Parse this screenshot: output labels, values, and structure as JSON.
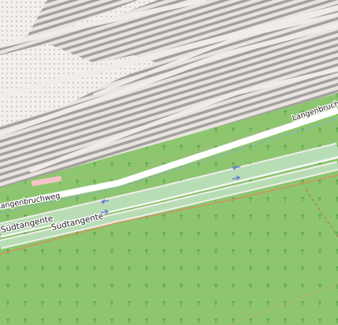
{
  "map": {
    "style": "OpenStreetMap Carto",
    "colors": {
      "meadow": "#8dc66f",
      "tree_dot": "#5da54a",
      "rail_yard_ground": "#e9e4e0",
      "rail_track": "#9d9b99",
      "gravel": "#f3efed",
      "gravel_dot": "#b7b1ad",
      "white_road": "#ffffff",
      "trunk_fill": "#b8ddb5",
      "trunk_casing": "#f0eeec",
      "oneway_arrow": "#6b7ed8",
      "footpath": "#f08070",
      "track_brown": "#a88a4a",
      "cycleway": "#8aa8dc",
      "bridge_pink": "#f2c6c6"
    },
    "road_labels": [
      {
        "id": "langenbruchweg_right",
        "text": "Langenbruchweg"
      },
      {
        "id": "langenbruchweg_left",
        "text": "Langenbruchweg"
      },
      {
        "id": "suedtangente_1",
        "text": "Südtangente"
      },
      {
        "id": "suedtangente_2",
        "text": "Südtangente"
      }
    ],
    "oneway_arrows": [
      "west",
      "east",
      "west",
      "east"
    ]
  }
}
